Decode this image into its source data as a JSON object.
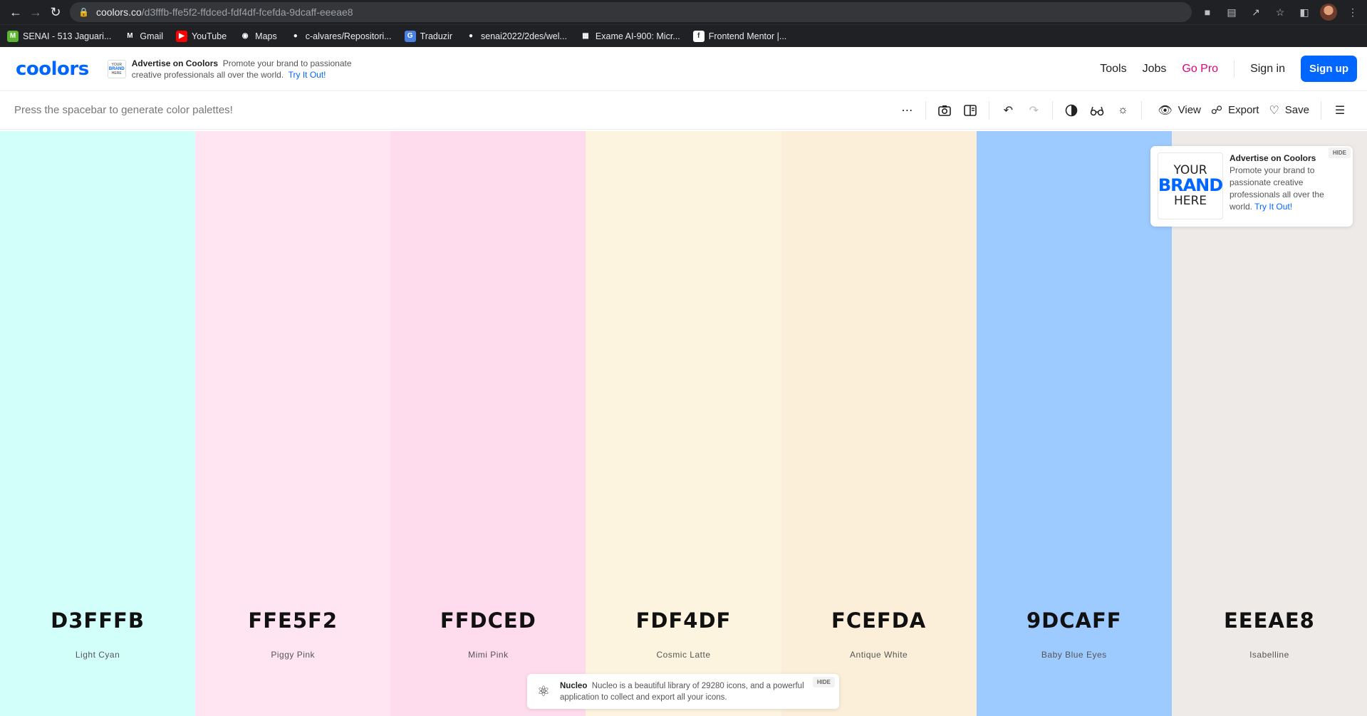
{
  "browser": {
    "url_host": "coolors.co",
    "url_path": "/d3fffb-ffe5f2-ffdced-fdf4df-fcefda-9dcaff-eeeae8",
    "bookmarks": [
      {
        "label": "SENAI - 513 Jaguari...",
        "icon": "senai-icon",
        "color": "#5bb531",
        "glyph": "M"
      },
      {
        "label": "Gmail",
        "icon": "gmail-icon",
        "color": "#202124",
        "glyph": "M"
      },
      {
        "label": "YouTube",
        "icon": "youtube-icon",
        "color": "#ff0000",
        "glyph": "▶"
      },
      {
        "label": "Maps",
        "icon": "maps-icon",
        "color": "#202124",
        "glyph": "◉"
      },
      {
        "label": "c-alvares/Repositori...",
        "icon": "github-icon",
        "color": "#202124",
        "glyph": "●"
      },
      {
        "label": "Traduzir",
        "icon": "translate-icon",
        "color": "#4a7fe6",
        "glyph": "G"
      },
      {
        "label": "senai2022/2des/wel...",
        "icon": "github-icon",
        "color": "#202124",
        "glyph": "●"
      },
      {
        "label": "Exame AI-900: Micr...",
        "icon": "microsoft-icon",
        "color": "#202124",
        "glyph": "▦"
      },
      {
        "label": "Frontend Mentor |...",
        "icon": "frontend-mentor-icon",
        "color": "#ffffff",
        "glyph": "f"
      }
    ]
  },
  "header": {
    "logo": "coolors",
    "ad": {
      "brand_top": "YOUR",
      "brand_mid": "BRAND",
      "brand_bot": "HERE",
      "title": "Advertise on Coolors",
      "text": "Promote your brand to passionate creative professionals all over the world.",
      "cta": "Try It Out!"
    },
    "nav": {
      "tools": "Tools",
      "jobs": "Jobs",
      "gopro": "Go Pro",
      "signin": "Sign in",
      "signup": "Sign up"
    }
  },
  "toolbar": {
    "hint": "Press the spacebar to generate color palettes!",
    "view": "View",
    "export": "Export",
    "save": "Save"
  },
  "palette": [
    {
      "hex": "D3FFFB",
      "name": "Light Cyan",
      "color": "#d3fffb"
    },
    {
      "hex": "FFE5F2",
      "name": "Piggy Pink",
      "color": "#ffe5f2"
    },
    {
      "hex": "FFDCED",
      "name": "Mimi Pink",
      "color": "#ffdced"
    },
    {
      "hex": "FDF4DF",
      "name": "Cosmic Latte",
      "color": "#fdf4df"
    },
    {
      "hex": "FCEFDA",
      "name": "Antique White",
      "color": "#fcefda"
    },
    {
      "hex": "9DCAFF",
      "name": "Baby Blue Eyes",
      "color": "#9dcaff"
    },
    {
      "hex": "EEEAE8",
      "name": "Isabelline",
      "color": "#eeeae8"
    }
  ],
  "ad_card": {
    "brand_top": "YOUR",
    "brand_mid": "BRAND",
    "brand_bot": "HERE",
    "title": "Advertise on Coolors",
    "text": "Promote your brand to passionate creative professionals all over the world.",
    "cta": "Try It Out!",
    "hide": "HIDE"
  },
  "nucleo": {
    "title": "Nucleo",
    "text": "Nucleo is a beautiful library of 29280 icons, and a powerful application to collect and export all your icons.",
    "hide": "HIDE"
  },
  "colors": {
    "accent": "#0066ff",
    "gopro": "#e5007a"
  }
}
